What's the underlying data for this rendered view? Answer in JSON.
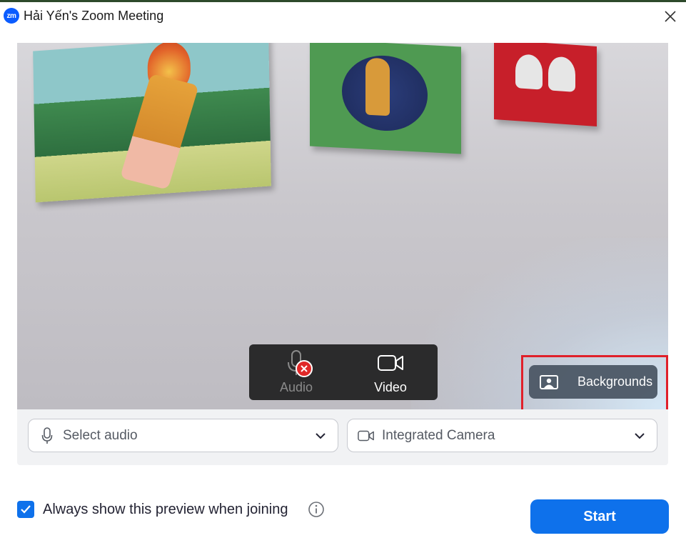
{
  "window": {
    "title": "Hải Yến's Zoom Meeting",
    "logo_text": "zm",
    "close_icon": "close-icon"
  },
  "preview": {
    "controls": {
      "audio_label": "Audio",
      "video_label": "Video",
      "audio_muted": true
    },
    "backgrounds_label": "Backgrounds"
  },
  "devices": {
    "audio": {
      "value": "Select audio",
      "icon": "microphone-icon"
    },
    "camera": {
      "value": "Integrated Camera",
      "icon": "camera-icon"
    }
  },
  "footer": {
    "always_show_label": "Always show this preview when joining",
    "always_show_checked": true,
    "start_label": "Start"
  },
  "colors": {
    "accent": "#0e71eb",
    "highlight": "#e0202a",
    "mute_red": "#e02828"
  }
}
